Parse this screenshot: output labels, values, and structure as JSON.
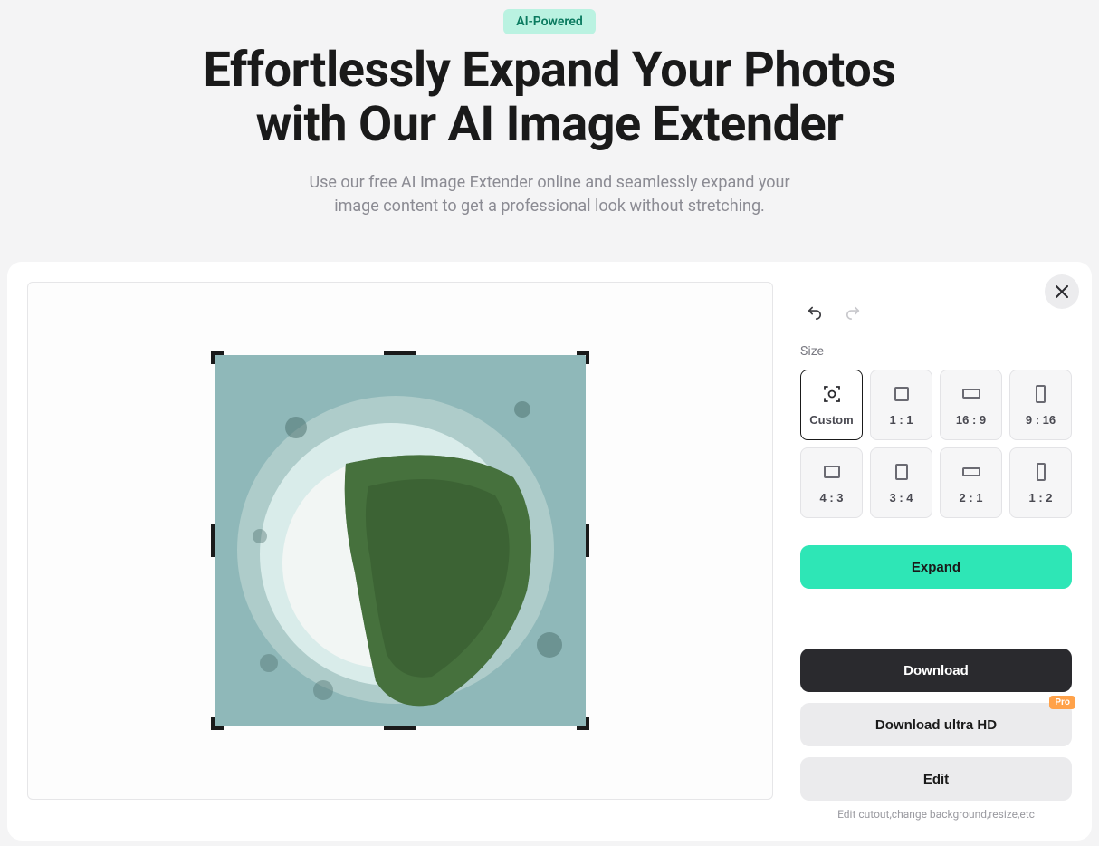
{
  "hero": {
    "badge": "AI-Powered",
    "title": "Effortlessly Expand Your Photos with Our AI Image Extender",
    "subtitle": "Use our free AI Image Extender online and seamlessly expand your image content to get a professional look without stretching."
  },
  "panel": {
    "size_label": "Size",
    "sizes": [
      {
        "label": "Custom",
        "selected": true
      },
      {
        "label": "1 : 1",
        "selected": false
      },
      {
        "label": "16 : 9",
        "selected": false
      },
      {
        "label": "9 : 16",
        "selected": false
      },
      {
        "label": "4 : 3",
        "selected": false
      },
      {
        "label": "3 : 4",
        "selected": false
      },
      {
        "label": "2 : 1",
        "selected": false
      },
      {
        "label": "1 : 2",
        "selected": false
      }
    ],
    "buttons": {
      "expand": "Expand",
      "download": "Download",
      "download_hd": "Download ultra HD",
      "pro": "Pro",
      "edit": "Edit",
      "edit_hint": "Edit cutout,change background,resize,etc"
    }
  }
}
